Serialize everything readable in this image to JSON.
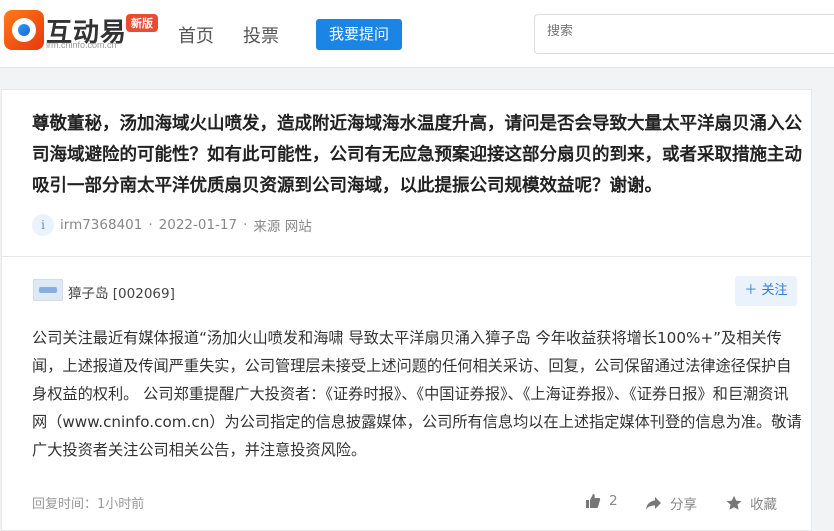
{
  "header": {
    "brand": "互动易",
    "brand_sub": "irm.cninfo.com.cn",
    "badge": "新版",
    "nav": [
      "首页",
      "投票"
    ],
    "ask_button": "我要提问",
    "search_placeholder": "搜索"
  },
  "question": {
    "text": "尊敬董秘，汤加海域火山喷发，造成附近海域海水温度升高，请问是否会导致大量太平洋扇贝涌入公司海域避险的可能性？如有此可能性，公司有无应急预案迎接这部分扇贝的到来，或者采取措施主动吸引一部分南太平洋优质扇贝资源到公司海域，以此提振公司规模效益呢？谢谢。",
    "user": "irm7368401",
    "date": "2022-01-17",
    "source": "来源 网站"
  },
  "answer": {
    "company": "獐子岛 [002069]",
    "follow_label": "＋ 关注",
    "text": "公司关注最近有媒体报道“汤加火山喷发和海啸 导致太平洋扇贝涌入獐子岛 今年收益获将增长100%+”及相关传闻，上述报道及传闻严重失实，公司管理层未接受上述问题的任何相关采访、回复，公司保留通过法律途径保护自身权益的权利。 公司郑重提醒广大投资者：《证券时报》、《中国证券报》、《上海证券报》、《证券日报》和巨潮资讯网（www.cninfo.com.cn）为公司指定的信息披露媒体，公司所有信息均以在上述指定媒体刊登的信息为准。敬请广大投资者关注公司相关公告，并注意投资风险。",
    "reply_time": "回复时间：1小时前",
    "likes": "2",
    "share_label": "分享",
    "fav_label": "收藏"
  },
  "colors": {
    "accent": "#1b85e6",
    "badge": "#e94b35"
  }
}
